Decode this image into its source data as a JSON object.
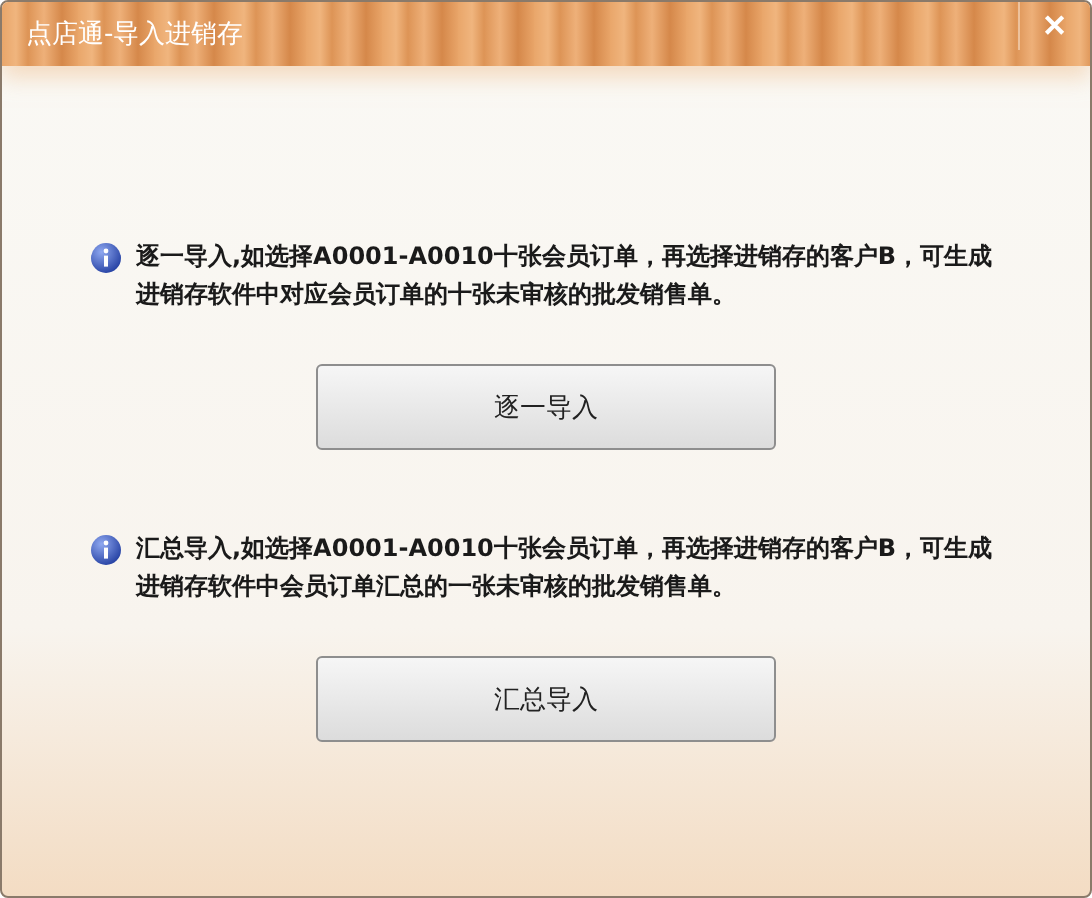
{
  "window": {
    "title": "点店通-导入进销存",
    "close": "✕"
  },
  "sections": [
    {
      "description": "逐一导入,如选择A0001-A0010十张会员订单，再选择进销存的客户B，可生成进销存软件中对应会员订单的十张未审核的批发销售单。",
      "button": "逐一导入"
    },
    {
      "description": "汇总导入,如选择A0001-A0010十张会员订单，再选择进销存的客户B，可生成进销存软件中会员订单汇总的一张未审核的批发销售单。",
      "button": "汇总导入"
    }
  ]
}
